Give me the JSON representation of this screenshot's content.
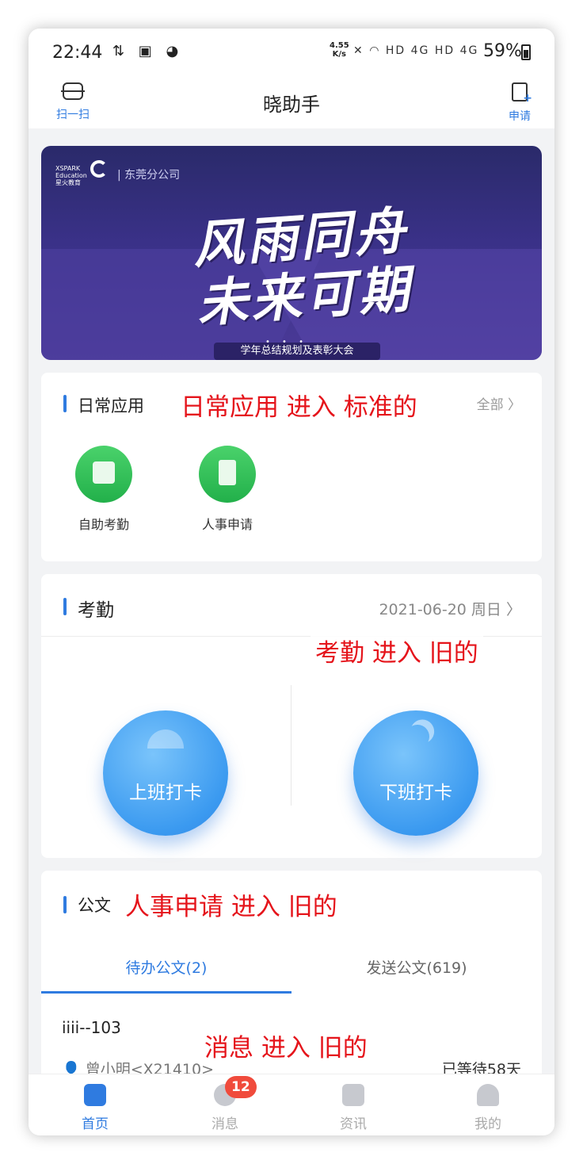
{
  "status_bar": {
    "time": "22:44",
    "speed_value": "4.55",
    "speed_unit": "K/s",
    "network": "HD 4G HD 4G",
    "battery": "59%"
  },
  "header": {
    "scan_label": "扫一扫",
    "title": "晓助手",
    "apply_label": "申请"
  },
  "banner": {
    "logo_text": "XSPARK Education 星火教育",
    "branch": "东莞分公司",
    "slogan_line1": "风雨同舟",
    "slogan_line2": "未来可期",
    "subtitle": "学年总结规划及表彰大会"
  },
  "daily_apps": {
    "title": "日常应用",
    "all_label": "全部",
    "items": [
      {
        "label": "自助考勤",
        "icon": "calendar-check-icon"
      },
      {
        "label": "人事申请",
        "icon": "document-plus-icon"
      }
    ]
  },
  "attendance": {
    "title": "考勤",
    "date": "2021-06-20 周日",
    "clock_in_label": "上班打卡",
    "clock_out_label": "下班打卡"
  },
  "documents": {
    "title": "公文",
    "tabs": [
      {
        "label": "待办公文(2)",
        "active": true
      },
      {
        "label": "发送公文(619)",
        "active": false
      }
    ],
    "item": {
      "title": "iiii--103",
      "person": "曾小明<X21410>",
      "wait": "已等待58天"
    }
  },
  "tab_bar": {
    "items": [
      {
        "label": "首页",
        "active": true
      },
      {
        "label": "消息",
        "badge": "12"
      },
      {
        "label": "资讯"
      },
      {
        "label": "我的"
      }
    ]
  },
  "annotations": {
    "daily": "日常应用 进入 标准的",
    "attendance": "考勤 进入 旧的",
    "documents": "人事申请 进入 旧的",
    "messages": "消息 进入 旧的"
  },
  "colors": {
    "accent": "#2f7be0",
    "green": "#22b04a",
    "badge": "#f04b3c",
    "annotation": "#e5141b"
  }
}
